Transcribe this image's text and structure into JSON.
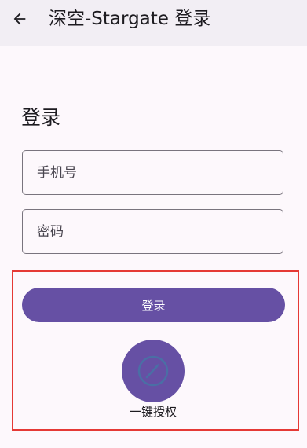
{
  "app_bar": {
    "title": "深空-Stargate 登录",
    "back_icon": "arrow-back-icon"
  },
  "page": {
    "heading": "登录"
  },
  "form": {
    "phone_placeholder": "手机号",
    "phone_value": "",
    "password_placeholder": "密码",
    "password_value": ""
  },
  "actions": {
    "login_label": "登录",
    "one_tap_label": "一键授权",
    "one_tap_icon": "compass-icon"
  },
  "colors": {
    "primary": "#6650a4",
    "app_bar_bg": "#f2eef4",
    "background": "#fdf8fc",
    "highlight": "#e53935"
  }
}
